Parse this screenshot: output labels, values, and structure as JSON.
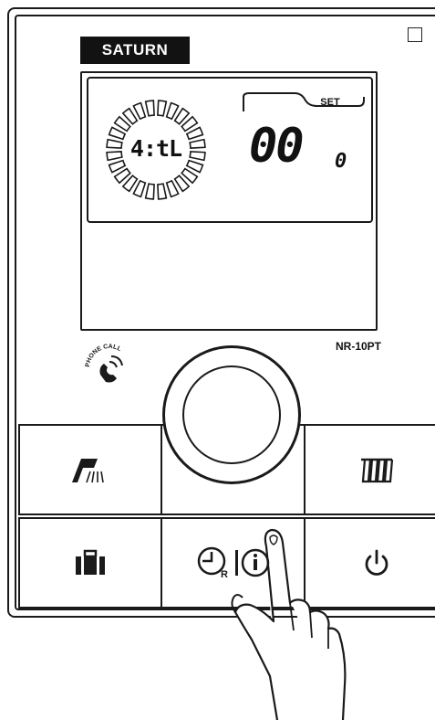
{
  "brand": {
    "label": "SATURN"
  },
  "display": {
    "time_text": "4:tL",
    "set_label": "SET",
    "value_main": "00",
    "value_small": "0"
  },
  "model": {
    "label": "NR-10PT"
  },
  "phone_call": {
    "label": "PHONE CALL"
  },
  "buttons": [
    {
      "name": "shower",
      "icon": "shower-icon"
    },
    {
      "name": "heating",
      "icon": "radiator-icon"
    },
    {
      "name": "away",
      "icon": "suitcase-icon"
    },
    {
      "name": "reservation-info",
      "icon": "clock-r-info-icon"
    },
    {
      "name": "power",
      "icon": "power-icon"
    }
  ],
  "colors": {
    "ink": "#1a1a1a",
    "background": "#ffffff"
  }
}
